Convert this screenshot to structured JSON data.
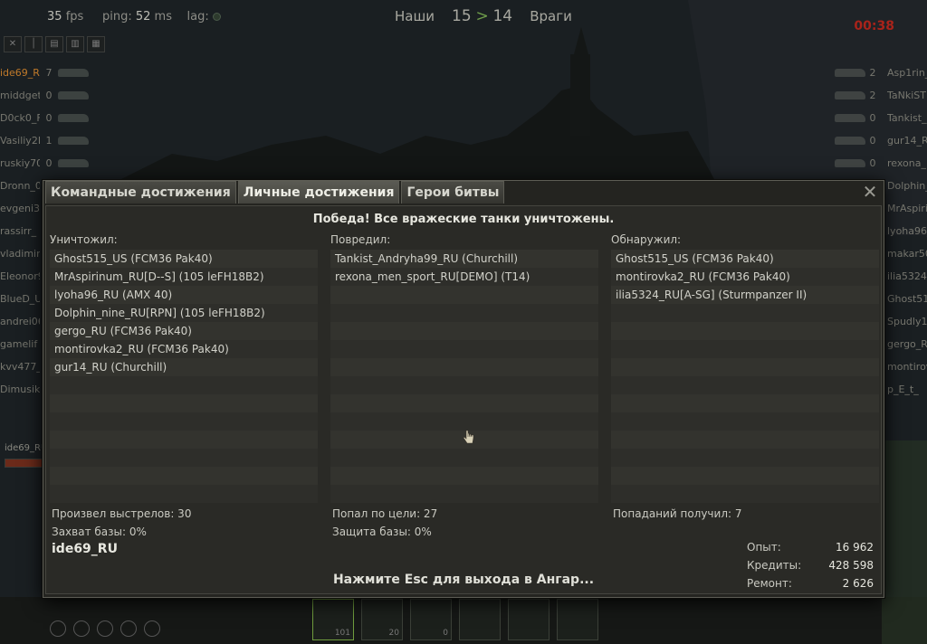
{
  "hud": {
    "fps_value": "35",
    "fps_label": "fps",
    "ping_label": "ping:",
    "ping_value": "52",
    "ping_unit": "ms",
    "lag_label": "lag:",
    "allies_label": "Наши",
    "allies_score": "15",
    "score_arrow": ">",
    "enemies_score": "14",
    "enemies_label": "Враги",
    "timer": "00:38"
  },
  "team_left": [
    {
      "name": "ide69_R",
      "kills": "7"
    },
    {
      "name": "middget",
      "kills": "0"
    },
    {
      "name": "D0ck0_F",
      "kills": "0"
    },
    {
      "name": "Vasiliy2I",
      "kills": "1"
    },
    {
      "name": "ruskiy70",
      "kills": "0"
    },
    {
      "name": "Dronn_0",
      "kills": ""
    },
    {
      "name": "evgeni35",
      "kills": ""
    },
    {
      "name": "rassirr_",
      "kills": ""
    },
    {
      "name": "vladimir",
      "kills": ""
    },
    {
      "name": "Eleonor9",
      "kills": ""
    },
    {
      "name": "BlueD_U",
      "kills": ""
    },
    {
      "name": "andrei06",
      "kills": ""
    },
    {
      "name": "gamelif",
      "kills": ""
    },
    {
      "name": "kvv477_",
      "kills": ""
    },
    {
      "name": "Dimusik7",
      "kills": ""
    }
  ],
  "team_right": [
    {
      "name": "Asp1rin_",
      "kills": "2"
    },
    {
      "name": "TaNkiST",
      "kills": "2"
    },
    {
      "name": "Tankist_",
      "kills": "0"
    },
    {
      "name": "gur14_R",
      "kills": "0"
    },
    {
      "name": "rexona_",
      "kills": "0"
    },
    {
      "name": "Dolphin_",
      "kills": ""
    },
    {
      "name": "MrAspiril",
      "kills": ""
    },
    {
      "name": "lyoha96_",
      "kills": ""
    },
    {
      "name": "makar50",
      "kills": ""
    },
    {
      "name": "ilia5324",
      "kills": ""
    },
    {
      "name": "Ghost515",
      "kills": ""
    },
    {
      "name": "Spudly13",
      "kills": ""
    },
    {
      "name": "gergo_RI",
      "kills": ""
    },
    {
      "name": "montirov",
      "kills": ""
    },
    {
      "name": "p_E_t_",
      "kills": ""
    }
  ],
  "hud_player_label": "ide69_RU",
  "ammo": [
    {
      "count": "101"
    },
    {
      "count": "20"
    },
    {
      "count": "0"
    },
    {
      "count": ""
    },
    {
      "count": ""
    },
    {
      "count": ""
    }
  ],
  "dialog": {
    "tabs": [
      "Командные достижения",
      "Личные достижения",
      "Герои битвы"
    ],
    "active_tab": 1,
    "victory_text": "Победа! Все вражеские танки уничтожены.",
    "destroyed_label": "Уничтожил:",
    "damaged_label": "Повредил:",
    "spotted_label": "Обнаружил:",
    "destroyed": [
      "Ghost515_US (FCM36 Pak40)",
      "MrAspirinum_RU[D--S] (105 leFH18B2)",
      "lyoha96_RU (AMX 40)",
      "Dolphin_nine_RU[RPN] (105 leFH18B2)",
      "gergo_RU (FCM36 Pak40)",
      "montirovka2_RU (FCM36 Pak40)",
      "gur14_RU (Churchill)"
    ],
    "damaged": [
      "Tankist_Andryha99_RU (Churchill)",
      "rexona_men_sport_RU[DEMO] (T14)"
    ],
    "spotted": [
      "Ghost515_US (FCM36 Pak40)",
      "montirovka2_RU (FCM36 Pak40)",
      "ilia5324_RU[A-SG] (Sturmpanzer II)"
    ],
    "shots_fired": "Произвел выстрелов: 30",
    "base_capture": "Захват базы: 0%",
    "hits": "Попал по цели: 27",
    "base_defense": "Защита базы: 0%",
    "hits_received": "Попаданий получил: 7",
    "player_name": "ide69_RU",
    "xp_label": "Опыт:",
    "xp_value": "16 962",
    "credits_label": "Кредиты:",
    "credits_value": "428 598",
    "repair_label": "Ремонт:",
    "repair_value": "2 626",
    "esc_hint": "Нажмите Esc для выхода в Ангар..."
  },
  "colors": {
    "timer": "#a9231a",
    "score_arrow": "#6e9c4a",
    "panel_bg": "#2a2a26"
  }
}
